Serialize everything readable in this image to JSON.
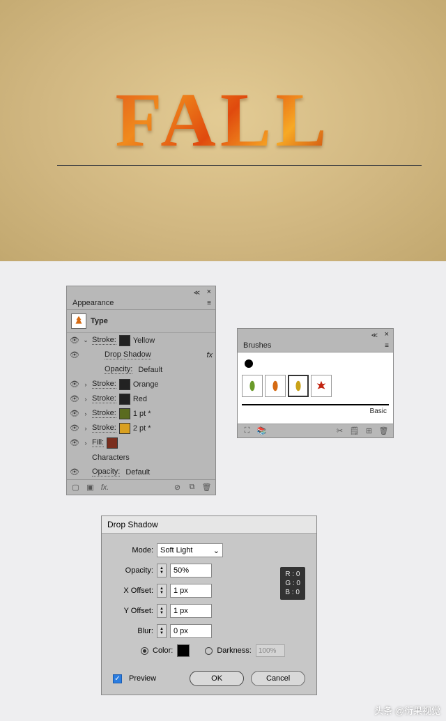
{
  "hero": {
    "text": "FALL"
  },
  "appearance": {
    "title": "Appearance",
    "type_label": "Type",
    "rows": [
      {
        "eye": true,
        "expand": "v",
        "label": "Stroke:",
        "swatch": "#222222",
        "value": "Yellow"
      },
      {
        "eye": true,
        "indent": true,
        "label": "Drop Shadow",
        "fx": true
      },
      {
        "eye": false,
        "indent": true,
        "label": "Opacity:",
        "value": "Default"
      },
      {
        "eye": true,
        "expand": ">",
        "label": "Stroke:",
        "swatch": "#222222",
        "value": "Orange"
      },
      {
        "eye": true,
        "expand": ">",
        "label": "Stroke:",
        "swatch": "#222222",
        "value": "Red"
      },
      {
        "eye": true,
        "expand": ">",
        "label": "Stroke:",
        "swatch": "#5a6b1f",
        "value": "1 pt *"
      },
      {
        "eye": true,
        "expand": ">",
        "label": "Stroke:",
        "swatch": "#d9a020",
        "value": "2 pt *"
      },
      {
        "eye": true,
        "expand": ">",
        "label": "Fill:",
        "swatch": "#7a2e1e",
        "value": ""
      },
      {
        "indent": true,
        "label": "Characters"
      },
      {
        "eye": true,
        "indent": true,
        "label": "Opacity:",
        "value": "Default"
      }
    ],
    "footer_fx": "fx."
  },
  "brushes": {
    "title": "Brushes",
    "basic_label": "Basic",
    "items": [
      {
        "icon": "leaf-green",
        "color": "#6a9a2a"
      },
      {
        "icon": "leaf-orange",
        "color": "#d56a12"
      },
      {
        "icon": "leaf-yellow",
        "color": "#c9a218",
        "selected": true
      },
      {
        "icon": "leaf-maple",
        "color": "#c22310"
      }
    ]
  },
  "dialog": {
    "title": "Drop Shadow",
    "mode_label": "Mode:",
    "mode_value": "Soft Light",
    "opacity_label": "Opacity:",
    "opacity_value": "50%",
    "xoff_label": "X Offset:",
    "xoff_value": "1 px",
    "yoff_label": "Y Offset:",
    "yoff_value": "1 px",
    "blur_label": "Blur:",
    "blur_value": "0 px",
    "color_label": "Color:",
    "color_swatch": "#000000",
    "darkness_label": "Darkness:",
    "darkness_value": "100%",
    "preview_label": "Preview",
    "preview_checked": true,
    "ok": "OK",
    "cancel": "Cancel",
    "rgb": {
      "r": "R : 0",
      "g": "G : 0",
      "b": "B : 0"
    }
  },
  "watermark": "头条 @衍果视觉"
}
